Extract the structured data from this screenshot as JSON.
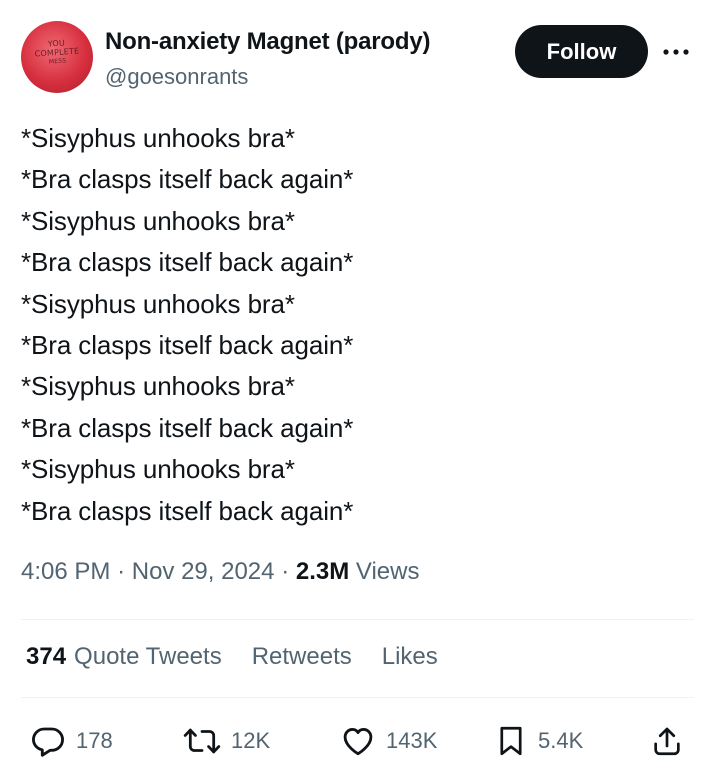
{
  "author": {
    "display_name": "Non-anxiety Magnet (parody)",
    "handle": "@goesonrants",
    "avatar_text": [
      "YOU",
      "COMPLETE",
      "MESS"
    ]
  },
  "header": {
    "follow_label": "Follow",
    "more_icon": "more-horizontal-icon"
  },
  "tweet": {
    "lines": [
      "*Sisyphus unhooks bra*",
      "*Bra clasps itself back again*",
      "*Sisyphus unhooks bra*",
      "*Bra clasps itself back again*",
      "*Sisyphus unhooks bra*",
      "*Bra clasps itself back again*",
      "*Sisyphus unhooks bra*",
      "*Bra clasps itself back again*",
      "*Sisyphus unhooks bra*",
      "*Bra clasps itself back again*"
    ]
  },
  "meta": {
    "time": "4:06 PM",
    "separator": "·",
    "date": "Nov 29, 2024",
    "views_count": "2.3M",
    "views_label": "Views"
  },
  "engagement": {
    "quote_count": "374",
    "quote_label": "Quote Tweets",
    "retweets_label": "Retweets",
    "likes_label": "Likes"
  },
  "actions": {
    "reply_count": "178",
    "retweet_count": "12K",
    "like_count": "143K",
    "bookmark_count": "5.4K"
  },
  "colors": {
    "text": "#0f1419",
    "secondary": "#536471",
    "divider": "#eff3f4",
    "follow_bg": "#0f1419",
    "avatar": "#d7303f"
  }
}
